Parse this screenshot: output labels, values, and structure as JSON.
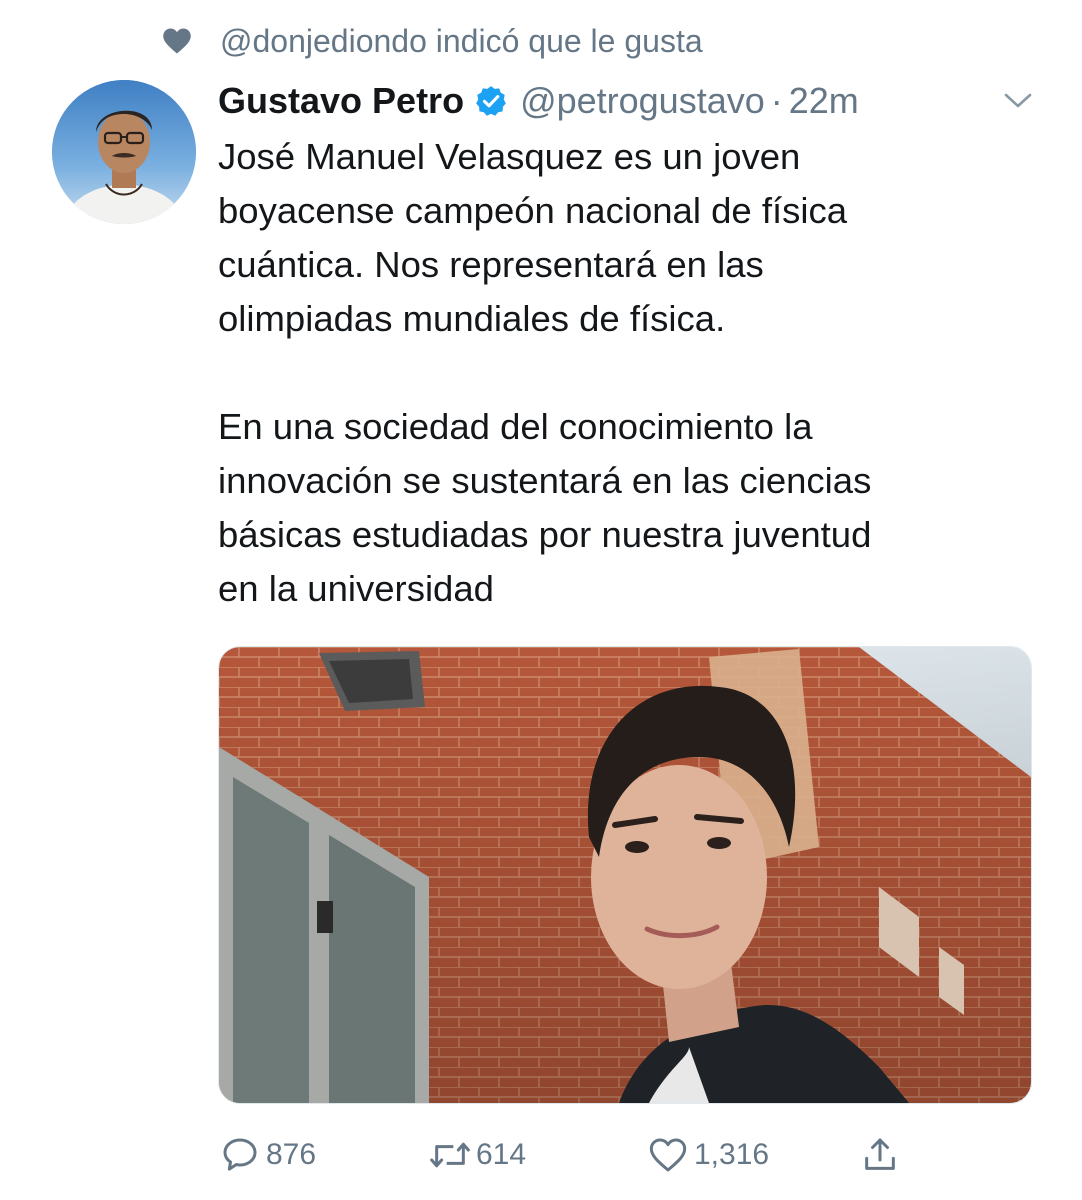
{
  "social_context": {
    "text": "@donjediondo indicó que le gusta",
    "icon": "heart-icon"
  },
  "tweet": {
    "author_name": "Gustavo Petro",
    "verified_icon": "verified-badge-icon",
    "handle": "@petrogustavo",
    "separator": "·",
    "time": "22m",
    "text": "José Manuel Velasquez es un joven\nboyacense campeón nacional de física\ncuántica. Nos representará en las\nolimpiadas mundiales de física.\n\nEn una sociedad del conocimiento la\ninnovación se sustentará en las ciencias\nbásicas estudiadas por nuestra juventud\nen la universidad",
    "media_icon": "photo",
    "avatar_icon": "avatar-photo"
  },
  "actions": {
    "reply": {
      "icon": "reply-icon",
      "count": "876"
    },
    "retweet": {
      "icon": "retweet-icon",
      "count": "614"
    },
    "like": {
      "icon": "like-icon",
      "count": "1,316"
    },
    "share": {
      "icon": "share-icon"
    }
  },
  "colors": {
    "secondary_text": "#657786",
    "primary_text": "#14171a",
    "verified_blue": "#1da1f2"
  }
}
